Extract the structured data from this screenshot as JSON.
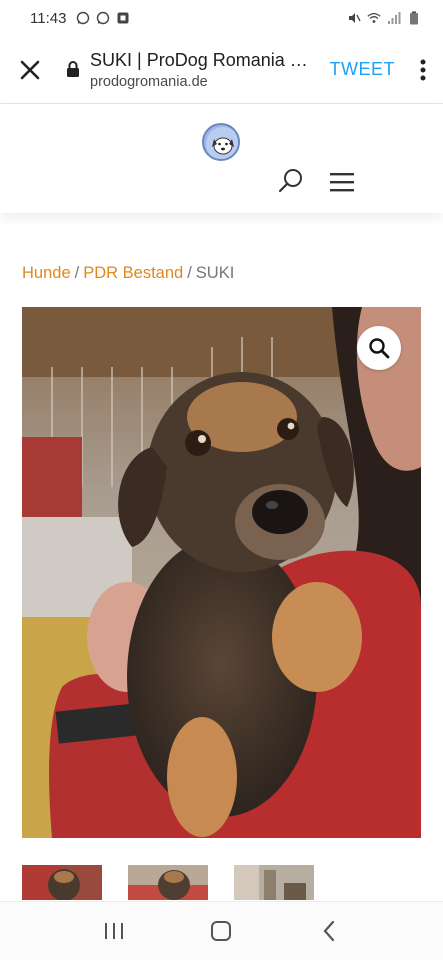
{
  "status_bar": {
    "time": "11:43",
    "left_icons": [
      "whatsapp-icon",
      "whatsapp-icon",
      "app-notification-icon"
    ],
    "right_icons": [
      "mute-icon",
      "wifi-icon",
      "signal-icon",
      "battery-icon"
    ]
  },
  "tab_bar": {
    "title": "SUKI | ProDog Romania e.V.",
    "url": "prodogromania.de",
    "tweet_label": "TWEET"
  },
  "breadcrumb": {
    "items": [
      {
        "label": "Hunde"
      },
      {
        "label": "PDR Bestand"
      }
    ],
    "separator": "/",
    "current": "SUKI"
  },
  "colors": {
    "accent_link": "#e0891a",
    "tweet_blue": "#1da1f2"
  },
  "gallery": {
    "main_alt": "photo-of-puppy-suki",
    "thumbnail_count": 3
  }
}
